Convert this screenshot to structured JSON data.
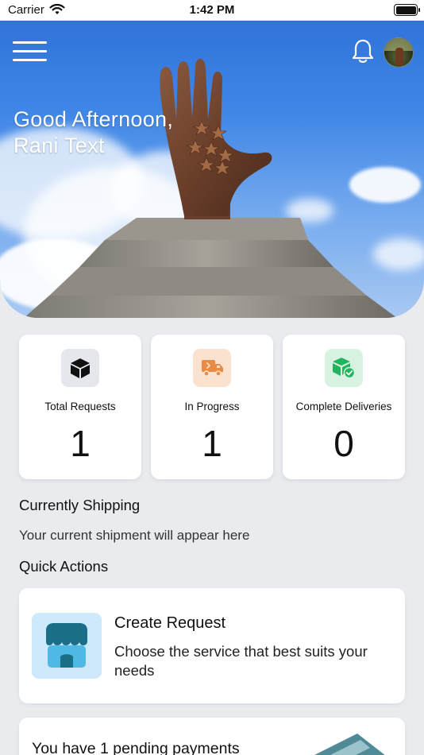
{
  "status_bar": {
    "carrier": "Carrier",
    "time": "1:42 PM"
  },
  "greeting": {
    "line1": "Good Afternoon,",
    "line2": "Rani Text"
  },
  "stats": [
    {
      "label": "Total Requests",
      "value": "1",
      "icon": "package-icon",
      "icon_bg": "#e5e7ec"
    },
    {
      "label": "In Progress",
      "value": "1",
      "icon": "truck-icon",
      "icon_bg": "#fbe2cf"
    },
    {
      "label": "Complete Deliveries",
      "value": "0",
      "icon": "package-check-icon",
      "icon_bg": "#d7f2e0"
    }
  ],
  "currently_shipping": {
    "title": "Currently Shipping",
    "empty_text": "Your current shipment will appear here"
  },
  "quick_actions": {
    "title": "Quick Actions",
    "create_request": {
      "title": "Create Request",
      "description": "Choose the service that best suits your needs",
      "icon": "storefront-icon"
    }
  },
  "pending": {
    "text": "You have 1 pending payments",
    "icon": "card-icon"
  },
  "colors": {
    "accent_orange": "#ea8a45",
    "accent_green": "#22b35e",
    "tile_blue": "#cde9fb",
    "store_teal": "#1a6e86"
  }
}
